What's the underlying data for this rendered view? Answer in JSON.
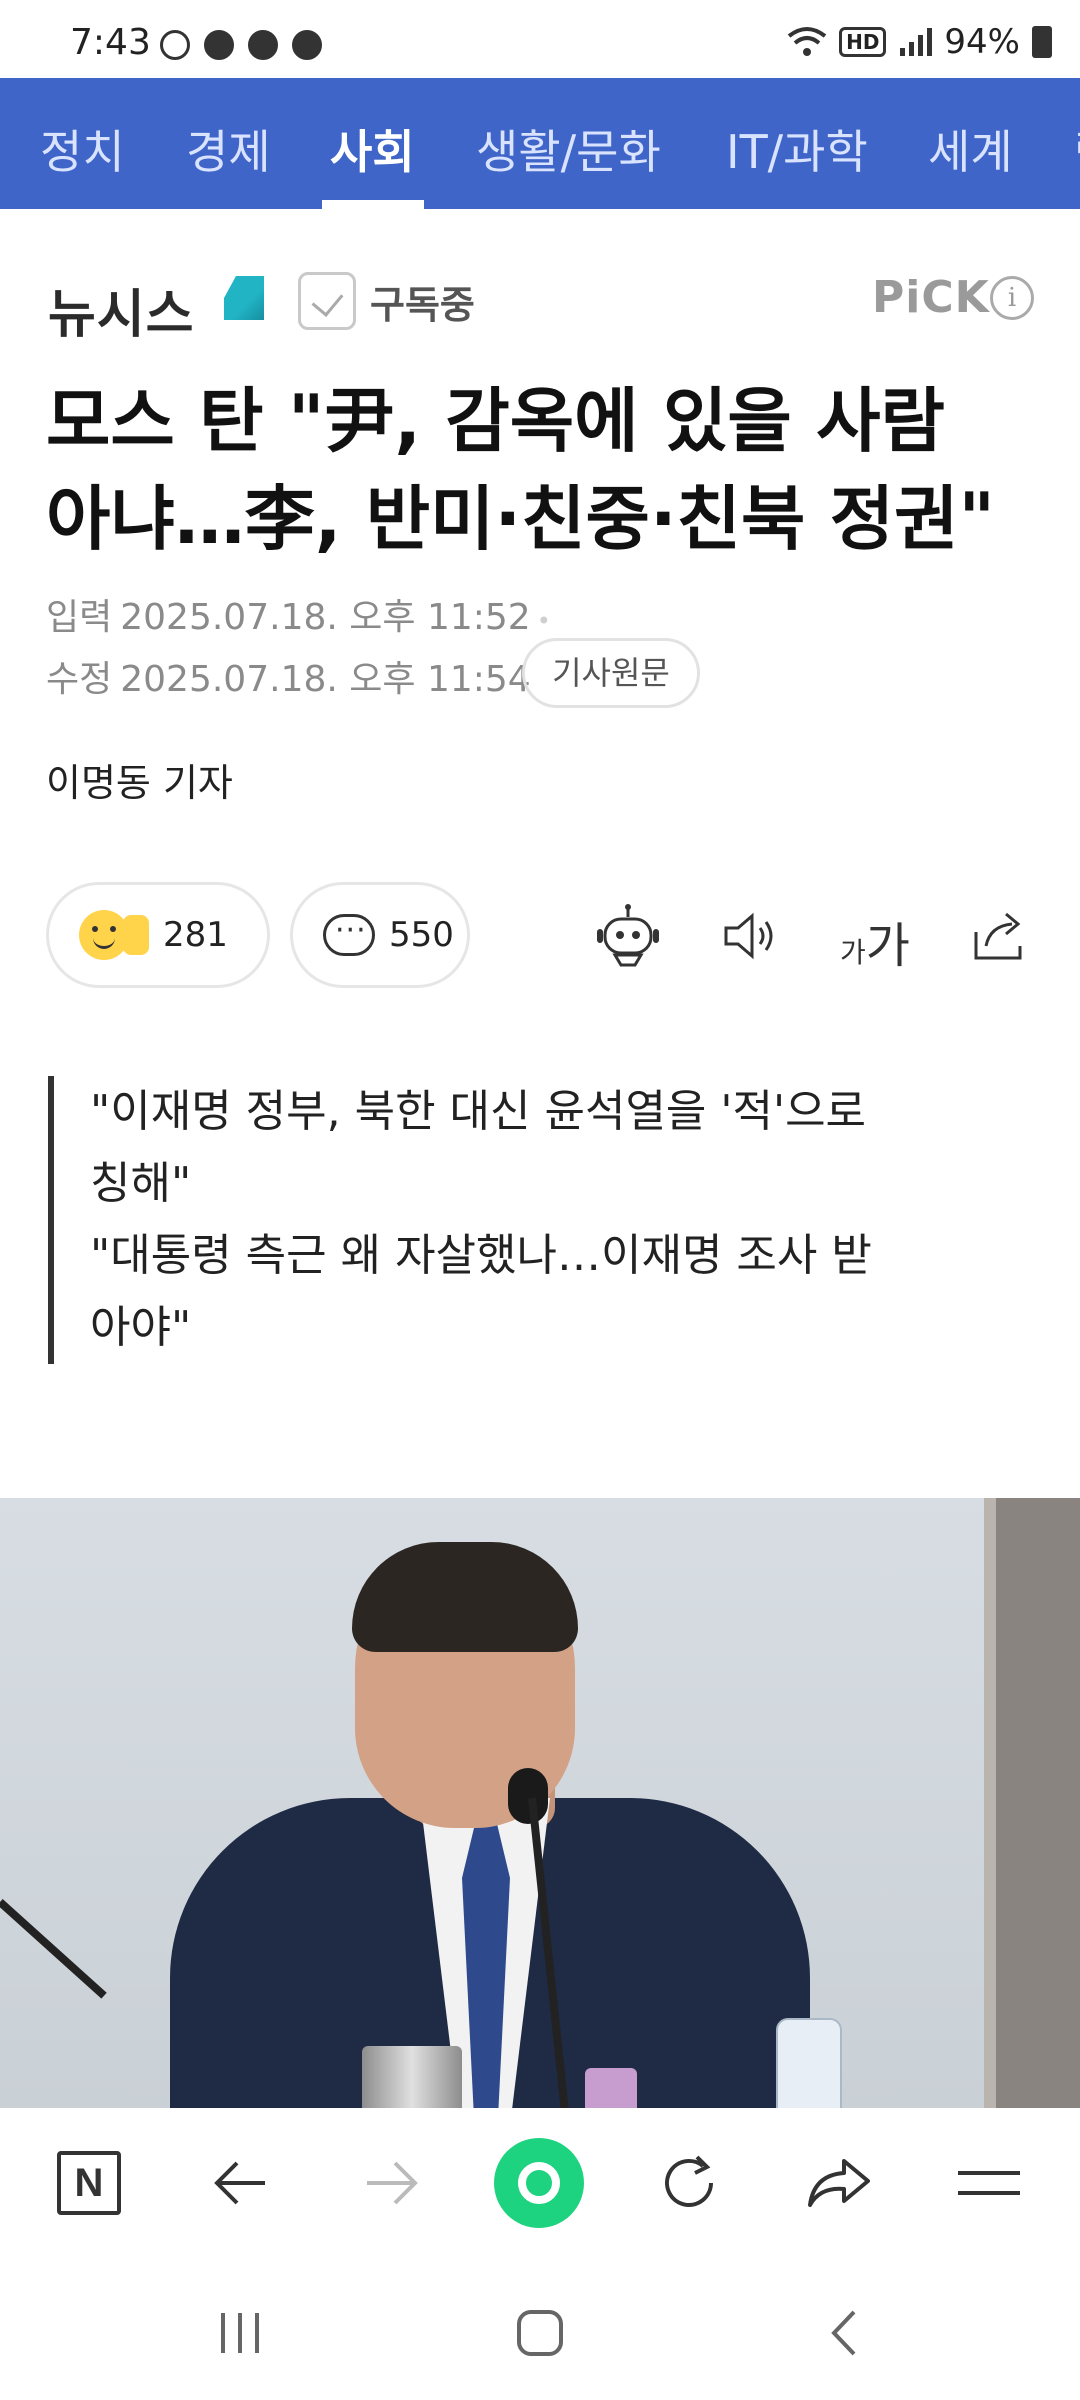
{
  "status_bar": {
    "time": "7:43",
    "battery": "94%",
    "hd_label": "HD"
  },
  "categories": [
    {
      "label": "정치",
      "active": false
    },
    {
      "label": "경제",
      "active": false
    },
    {
      "label": "사회",
      "active": true
    },
    {
      "label": "생활/문화",
      "active": false
    },
    {
      "label": "IT/과학",
      "active": false
    },
    {
      "label": "세계",
      "active": false
    },
    {
      "label": "랭",
      "active": false
    }
  ],
  "press": {
    "name": "뉴시스",
    "subscribe_label": "구독중",
    "pick_label": "PiCK",
    "info_glyph": "i"
  },
  "article": {
    "headline_line1": "모스 탄 \"尹, 감옥에 있을 사람",
    "headline_line2": "아냐…李, 반미·친중·친북 정권\"",
    "input_label": "입력",
    "input_date": "2025.07.18. 오후 11:52",
    "modified_label": "수정",
    "modified_date": "2025.07.18. 오후 11:54",
    "original_button": "기사원문",
    "reporter": "이명동 기자",
    "subhead": [
      "\"이재명 정부, 북한 대신 윤석열을 '적'으로",
      "칭해\"",
      "\"대통령 측근 왜 자살했나…이재명 조사 받",
      "아야\""
    ]
  },
  "reactions": {
    "like_count": "281",
    "comment_count": "550"
  },
  "tools": {
    "font_small": "가",
    "font_big": "가"
  },
  "icons": {
    "summary_bot": "robot-icon",
    "tts": "speaker-icon",
    "share": "share-icon",
    "toolbar_home": "naver-n-icon",
    "toolbar_back": "arrow-left-icon",
    "toolbar_forward": "arrow-right-icon",
    "toolbar_green": "green-dot-icon",
    "toolbar_refresh": "refresh-icon",
    "toolbar_share": "share-arrow-icon",
    "toolbar_menu": "menu-icon"
  },
  "toolbar": {
    "home_letter": "N"
  },
  "colors": {
    "nav_blue": "#3f65c8",
    "green": "#1dd37f",
    "press_teal": "#21b4c5"
  }
}
